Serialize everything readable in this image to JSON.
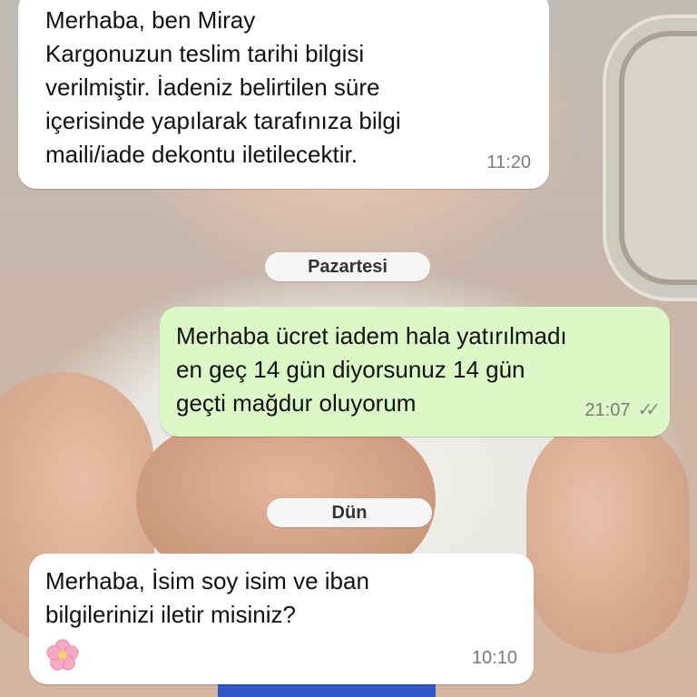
{
  "messages": [
    {
      "id": "m1",
      "direction": "incoming",
      "text": "Merhaba, ben Miray\nKargonuzun teslim tarihi bilgisi\nverilmiştir. İadeniz belirtilen süre\niçerisinde yapılarak tarafınıza bilgi\nmaili/iade dekontu iletilecektir.",
      "time": "11:20"
    },
    {
      "id": "m2",
      "direction": "outgoing",
      "text": "Merhaba ücret iadem hala yatırılmadı\nen geç 14 gün diyorsunuz 14 gün\ngeçti mağdur oluyorum",
      "time": "21:07",
      "status": "read"
    },
    {
      "id": "m3",
      "direction": "incoming",
      "text": "Merhaba, İsim soy isim ve iban\nbilgilerinizi iletir misiniz?",
      "emoji": "cherry-blossom-emoji",
      "time": "10:10"
    }
  ],
  "day_separators": [
    "Pazartesi",
    "Dün"
  ],
  "colors": {
    "incoming_bubble": "#ffffff",
    "outgoing_bubble": "#dcf8c6",
    "day_chip": "#f6f6f6"
  }
}
